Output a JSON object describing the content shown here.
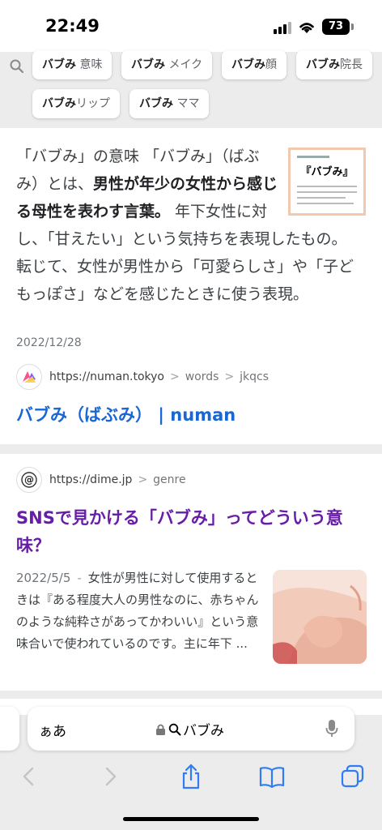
{
  "status": {
    "time": "22:49",
    "battery": "73"
  },
  "chips": [
    {
      "bold": "バブみ",
      "rest": " 意味"
    },
    {
      "bold": "バブみ",
      "rest": " メイク"
    },
    {
      "bold": "バブみ",
      "rest": "顔"
    },
    {
      "bold": "バブみ",
      "rest": "院長"
    },
    {
      "bold": "バブみ",
      "rest": "リップ"
    },
    {
      "bold": "バブみ",
      "rest": " ママ"
    }
  ],
  "result1": {
    "thumb_title": "『バブみ』",
    "snippet_pre": "「バブみ」の意味 「バブみ」（ばぶみ）とは、",
    "snippet_bold": "男性が年少の女性から感じる母性を表わす言葉。",
    "snippet_post": " 年下女性に対し、「甘えたい」という気持ちを表現したもの。 転じて、女性が男性から「可愛らしさ」や「子どもっぽさ」などを感じたときに使う表現。",
    "date": "2022/12/28",
    "site": "https://numan.tokyo",
    "path1": "words",
    "path2": "jkqcs",
    "title": "バブみ（ばぶみ） | numan"
  },
  "result2": {
    "site": "https://dime.jp",
    "path1": "genre",
    "title": "SNSで見かける「バブみ」ってどういう意味？",
    "date": "2022/5/5",
    "snippet": "女性が男性に対して使用するときは『ある程度大人の男性なのに、赤ちゃんのような純粋さがあってかわいい』という意味合いで使われているのです。主に年下 ..."
  },
  "address_bar": {
    "aa": "ぁあ",
    "query": "バブみ"
  },
  "colors": {
    "link_blue": "#1967d2",
    "visited_purple": "#681da8",
    "toolbar_blue": "#2f7cf6"
  },
  "icons": [
    "search-icon",
    "lock-icon",
    "mic-icon",
    "back-icon",
    "forward-icon",
    "share-icon",
    "bookmarks-icon",
    "tabs-icon"
  ]
}
